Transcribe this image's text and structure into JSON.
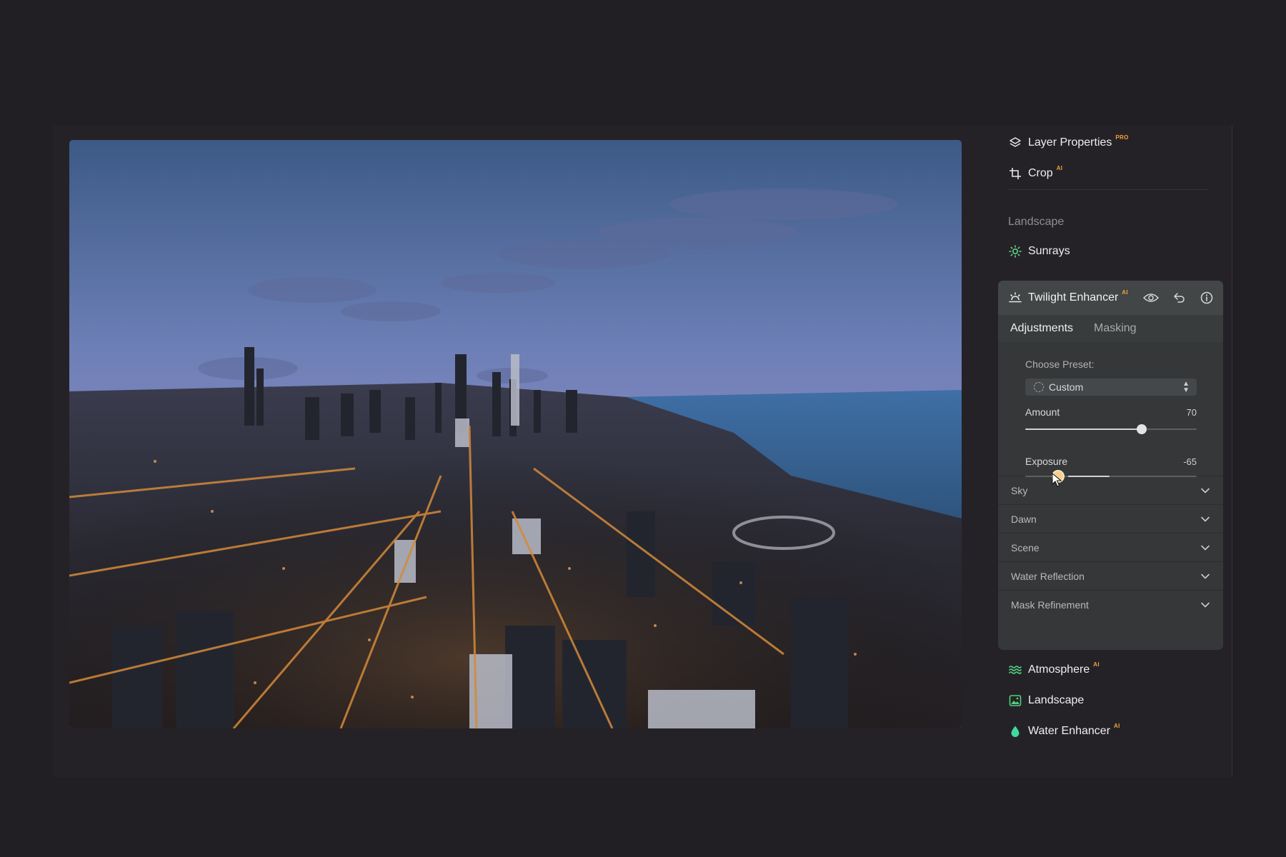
{
  "panel": {
    "top_items": [
      {
        "label": "Layer Properties",
        "badge": "PRO",
        "icon": "layers-icon"
      },
      {
        "label": "Crop",
        "badge": "AI",
        "icon": "crop-icon"
      }
    ],
    "section_title": "Landscape",
    "sunrays": {
      "label": "Sunrays",
      "icon": "sun-icon"
    },
    "card": {
      "title": "Twilight Enhancer",
      "badge": "AI",
      "icon": "twilight-icon",
      "tabs": [
        "Adjustments",
        "Masking"
      ],
      "active_tab": "Adjustments",
      "preset": {
        "label": "Choose Preset:",
        "value": "Custom"
      },
      "amount": {
        "label": "Amount",
        "value": "70",
        "level": 0.68
      },
      "exposure": {
        "label": "Exposure",
        "value": "-65",
        "thumb_level": 0.19,
        "fill_from": 0.25,
        "fill_to": 0.49
      },
      "sections": [
        "Sky",
        "Dawn",
        "Scene",
        "Water Reflection",
        "Mask Refinement"
      ]
    },
    "bottom_items": [
      {
        "label": "Atmosphere",
        "badge": "AI",
        "icon": "waves-icon",
        "color": "#4fd07a"
      },
      {
        "label": "Landscape",
        "badge": "",
        "icon": "image-icon",
        "color": "#4fd07a"
      },
      {
        "label": "Water Enhancer",
        "badge": "AI",
        "icon": "drop-icon",
        "color": "#3fd8a0"
      }
    ]
  }
}
